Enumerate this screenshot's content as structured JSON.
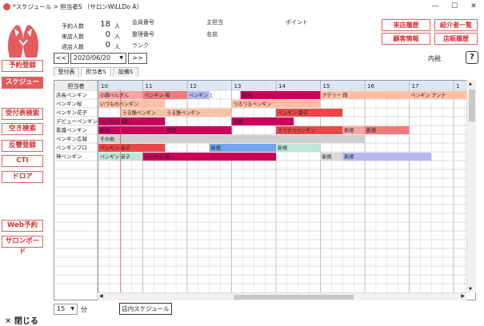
{
  "window": {
    "title": "*スケジュール > 担当者S （サロンWiLLDo A）",
    "controls": [
      "minimize-icon",
      "maximize-icon",
      "close-icon"
    ]
  },
  "sidebar": {
    "buttons": [
      {
        "label": "予約登録",
        "active": false
      },
      {
        "label": "スケジュール",
        "active": true
      },
      {
        "label": "受付表検索",
        "active": false
      },
      {
        "label": "空き検索",
        "active": false
      },
      {
        "label": "反響登録",
        "active": false
      },
      {
        "label": "CTI",
        "active": false
      },
      {
        "label": "ドロア",
        "active": false
      },
      {
        "label": "Web予約",
        "active": false
      },
      {
        "label": "サロンボード",
        "active": false
      }
    ],
    "close_label": "✕ 閉じる"
  },
  "stats": [
    {
      "label": "予約人数",
      "value": "18",
      "unit": "人"
    },
    {
      "label": "来店人数",
      "value": "0",
      "unit": "人"
    },
    {
      "label": "退店人数",
      "value": "0",
      "unit": "人"
    }
  ],
  "info": {
    "member_no": "会員番号",
    "manage_no": "整理番号",
    "rank": "ランク",
    "main_staff": "主担当",
    "name": "名前",
    "point": "ポイント"
  },
  "right_buttons": [
    "来店履歴",
    "紹介者一覧",
    "顧客情報",
    "店販履歴"
  ],
  "nav": {
    "prev": "<<",
    "date": "2020/06/20",
    "next": ">>",
    "tax": "内税",
    "help": "?"
  },
  "tabs": [
    {
      "label": "受付表",
      "selected": false
    },
    {
      "label": "担当者S",
      "selected": true
    },
    {
      "label": "設備S",
      "selected": false
    }
  ],
  "schedule": {
    "header_label": "担当者",
    "hours": [
      "10",
      "11",
      "12",
      "13",
      "14",
      "15",
      "16",
      "17",
      "1"
    ],
    "staff": [
      "店長ペンギン",
      "ペンギン桜",
      "ペンギン花子",
      "デビューペンギン",
      "看護ペンギン",
      "ペンギン広報",
      "ペンギンプロ",
      "神ペンギン"
    ],
    "current_time_offset_hours": 0.5,
    "bookings": [
      {
        "row": 0,
        "start": 0.0,
        "end": 1.0,
        "label": "小顔ぺんぎん",
        "color": "#f5a3a3"
      },
      {
        "row": 0,
        "start": 1.0,
        "end": 2.0,
        "label": "ペンギン 苺",
        "color": "#f07a7a"
      },
      {
        "row": 0,
        "start": 2.0,
        "end": 2.5,
        "label": "ペンギン 1",
        "color": "#b7b7f0"
      },
      {
        "row": 0,
        "start": 3.2,
        "end": 5.0,
        "label": "新規",
        "color": "#c8005a"
      },
      {
        "row": 0,
        "start": 5.0,
        "end": 7.0,
        "label": "アデリー 翔",
        "color": "#fbc0a5"
      },
      {
        "row": 0,
        "start": 7.0,
        "end": 8.4,
        "label": "ペンギン アンナ",
        "color": "#fbc0a5"
      },
      {
        "row": 1,
        "start": 0.0,
        "end": 1.5,
        "label": "いつものペンギン",
        "color": "#fbc0a5"
      },
      {
        "row": 1,
        "start": 3.0,
        "end": 5.0,
        "label": "つるつるペンギン",
        "color": "#fbc0a5"
      },
      {
        "row": 2,
        "start": 0.5,
        "end": 1.5,
        "label": "うる艶ペンギン",
        "color": "#fbc0a5"
      },
      {
        "row": 2,
        "start": 1.5,
        "end": 3.0,
        "label": "うる艶ペンギン",
        "color": "#fbc0a5"
      },
      {
        "row": 2,
        "start": 4.0,
        "end": 5.5,
        "label": "ペンギン 愛子",
        "color": "#e84848"
      },
      {
        "row": 3,
        "start": 0.0,
        "end": 1.5,
        "label": "ペンギン新規",
        "color": "#c8005a"
      },
      {
        "row": 3,
        "start": 3.0,
        "end": 4.4,
        "label": "新規",
        "color": "#c8005a"
      },
      {
        "row": 4,
        "start": 0.0,
        "end": 1.5,
        "label": "新規",
        "color": "#c8005a"
      },
      {
        "row": 4,
        "start": 1.5,
        "end": 3.0,
        "label": "新規",
        "color": "#c8005a"
      },
      {
        "row": 4,
        "start": 4.0,
        "end": 5.5,
        "label": "すべすべペンギン",
        "color": "#e84848"
      },
      {
        "row": 4,
        "start": 5.5,
        "end": 6.0,
        "label": "新規",
        "color": "#f5a3a3"
      },
      {
        "row": 4,
        "start": 6.0,
        "end": 7.0,
        "label": "新規",
        "color": "#f07a7a"
      },
      {
        "row": 5,
        "start": 0.0,
        "end": 6.0,
        "label": "その他",
        "color": "#cfcfcf"
      },
      {
        "row": 6,
        "start": 0.0,
        "end": 1.5,
        "label": "ペンギン 良子",
        "color": "#e84848"
      },
      {
        "row": 6,
        "start": 2.5,
        "end": 4.0,
        "label": "新規",
        "color": "#6fa8f0"
      },
      {
        "row": 6,
        "start": 4.0,
        "end": 5.0,
        "label": "新規",
        "color": "#bfe6d6"
      },
      {
        "row": 7,
        "start": 0.0,
        "end": 1.0,
        "label": "ペンギン 良子",
        "color": "#bfe6d6"
      },
      {
        "row": 7,
        "start": 1.0,
        "end": 4.0,
        "label": "ペンギン 姫",
        "color": "#c8005a"
      },
      {
        "row": 7,
        "start": 5.0,
        "end": 5.5,
        "label": "新規",
        "color": "#d9d9d9"
      },
      {
        "row": 7,
        "start": 5.5,
        "end": 7.5,
        "label": "新規",
        "color": "#b7b7f0"
      }
    ]
  },
  "bottom": {
    "interval_value": "15",
    "interval_unit": "分",
    "store_schedule": "店内スケジュール"
  }
}
